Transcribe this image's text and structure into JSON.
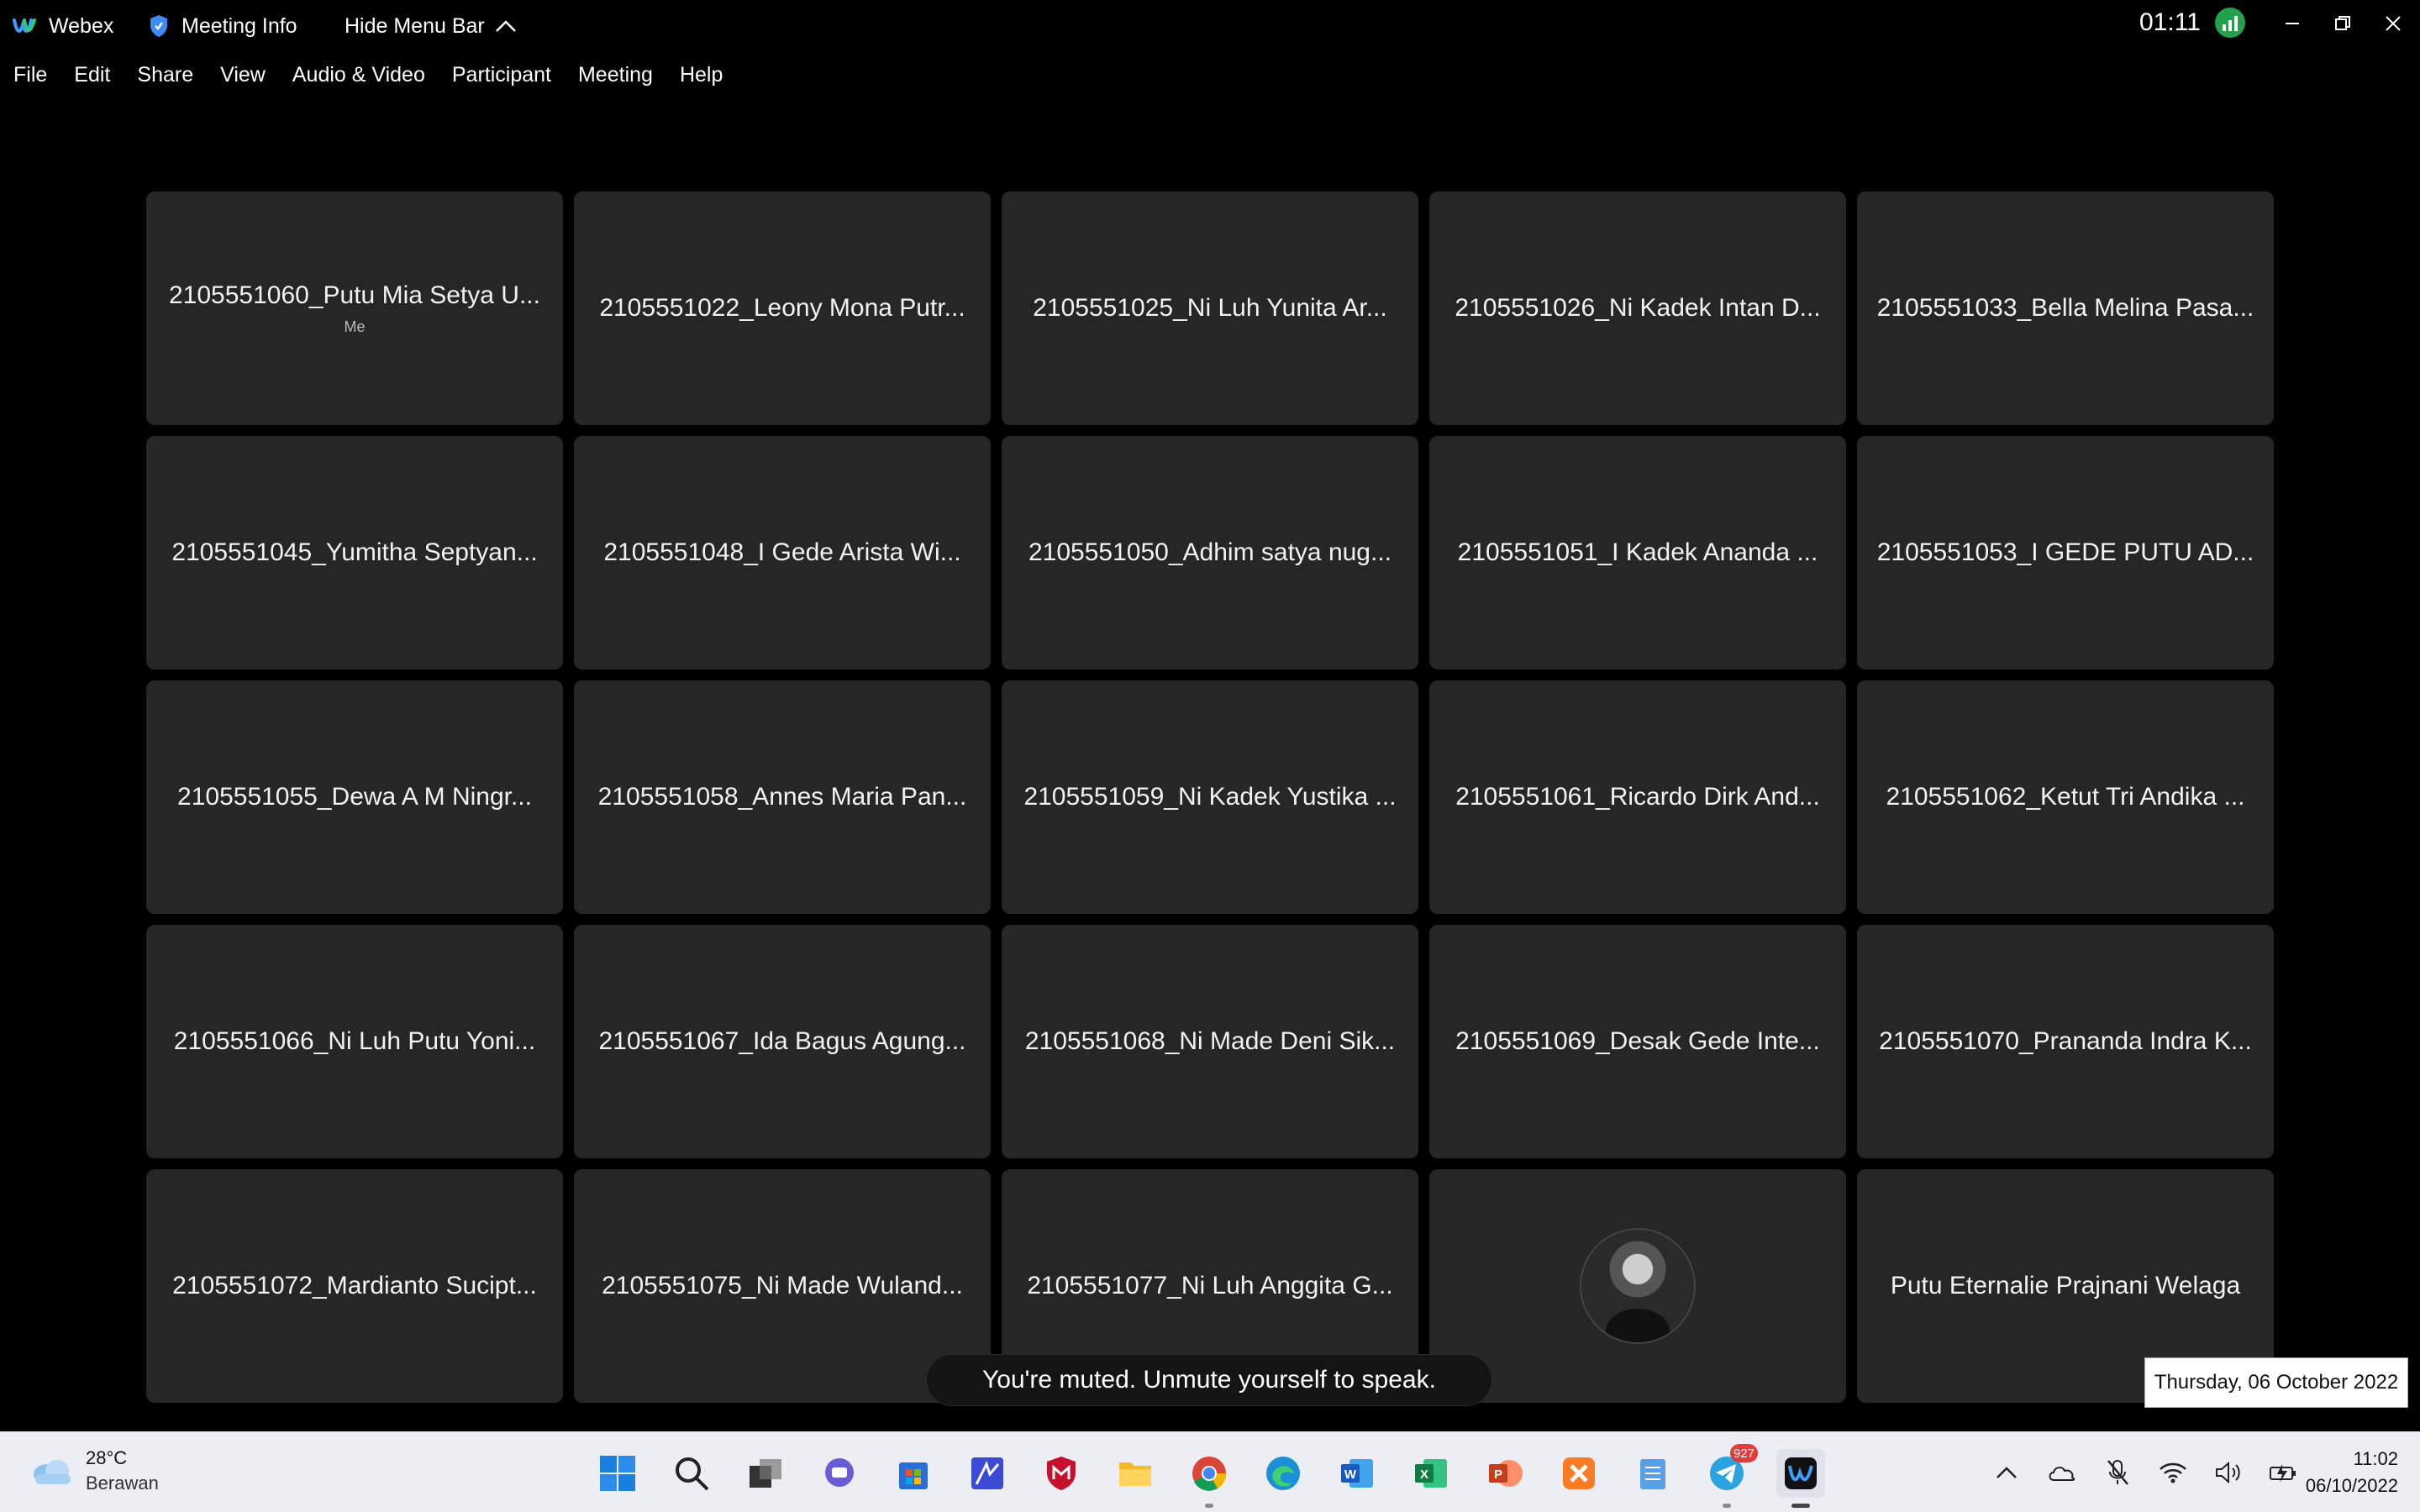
{
  "titlebar": {
    "app_name": "Webex",
    "meeting_info": "Meeting Info",
    "hide_menu_bar": "Hide Menu Bar",
    "timer": "01:11"
  },
  "menu": [
    "File",
    "Edit",
    "Share",
    "View",
    "Audio & Video",
    "Participant",
    "Meeting",
    "Help"
  ],
  "participants": [
    {
      "name": "2105551060_Putu Mia Setya U...",
      "sub": "Me"
    },
    {
      "name": "2105551022_Leony Mona Putr..."
    },
    {
      "name": "2105551025_Ni Luh Yunita Ar..."
    },
    {
      "name": "2105551026_Ni Kadek Intan D..."
    },
    {
      "name": "2105551033_Bella Melina Pasa..."
    },
    {
      "name": "2105551045_Yumitha Septyan..."
    },
    {
      "name": "2105551048_I Gede Arista Wi..."
    },
    {
      "name": "2105551050_Adhim satya nug..."
    },
    {
      "name": "2105551051_I Kadek Ananda ..."
    },
    {
      "name": "2105551053_I GEDE PUTU AD..."
    },
    {
      "name": "2105551055_Dewa A M Ningr..."
    },
    {
      "name": "2105551058_Annes Maria Pan..."
    },
    {
      "name": "2105551059_Ni Kadek Yustika ..."
    },
    {
      "name": "2105551061_Ricardo Dirk And..."
    },
    {
      "name": "2105551062_Ketut Tri Andika ..."
    },
    {
      "name": "2105551066_Ni Luh Putu Yoni..."
    },
    {
      "name": "2105551067_Ida Bagus Agung..."
    },
    {
      "name": "2105551068_Ni Made Deni Sik..."
    },
    {
      "name": "2105551069_Desak Gede Inte..."
    },
    {
      "name": "2105551070_Prananda Indra K..."
    },
    {
      "name": "2105551072_Mardianto Sucipt..."
    },
    {
      "name": "2105551075_Ni Made Wuland..."
    },
    {
      "name": "2105551077_Ni Luh Anggita G..."
    },
    {
      "name": "",
      "avatar": true
    },
    {
      "name": "Putu Eternalie Prajnani Welaga"
    }
  ],
  "toast": "You're muted. Unmute yourself to speak.",
  "date_tooltip": "Thursday, 06 October 2022",
  "taskbar": {
    "weather_temp": "28°C",
    "weather_cond": "Berawan",
    "telegram_badge": "927",
    "time": "11:02",
    "date": "06/10/2022"
  },
  "colors": {
    "background": "#000000",
    "tile": "#262626",
    "stat_green": "#22a34b",
    "taskbar": "#eceef3"
  }
}
